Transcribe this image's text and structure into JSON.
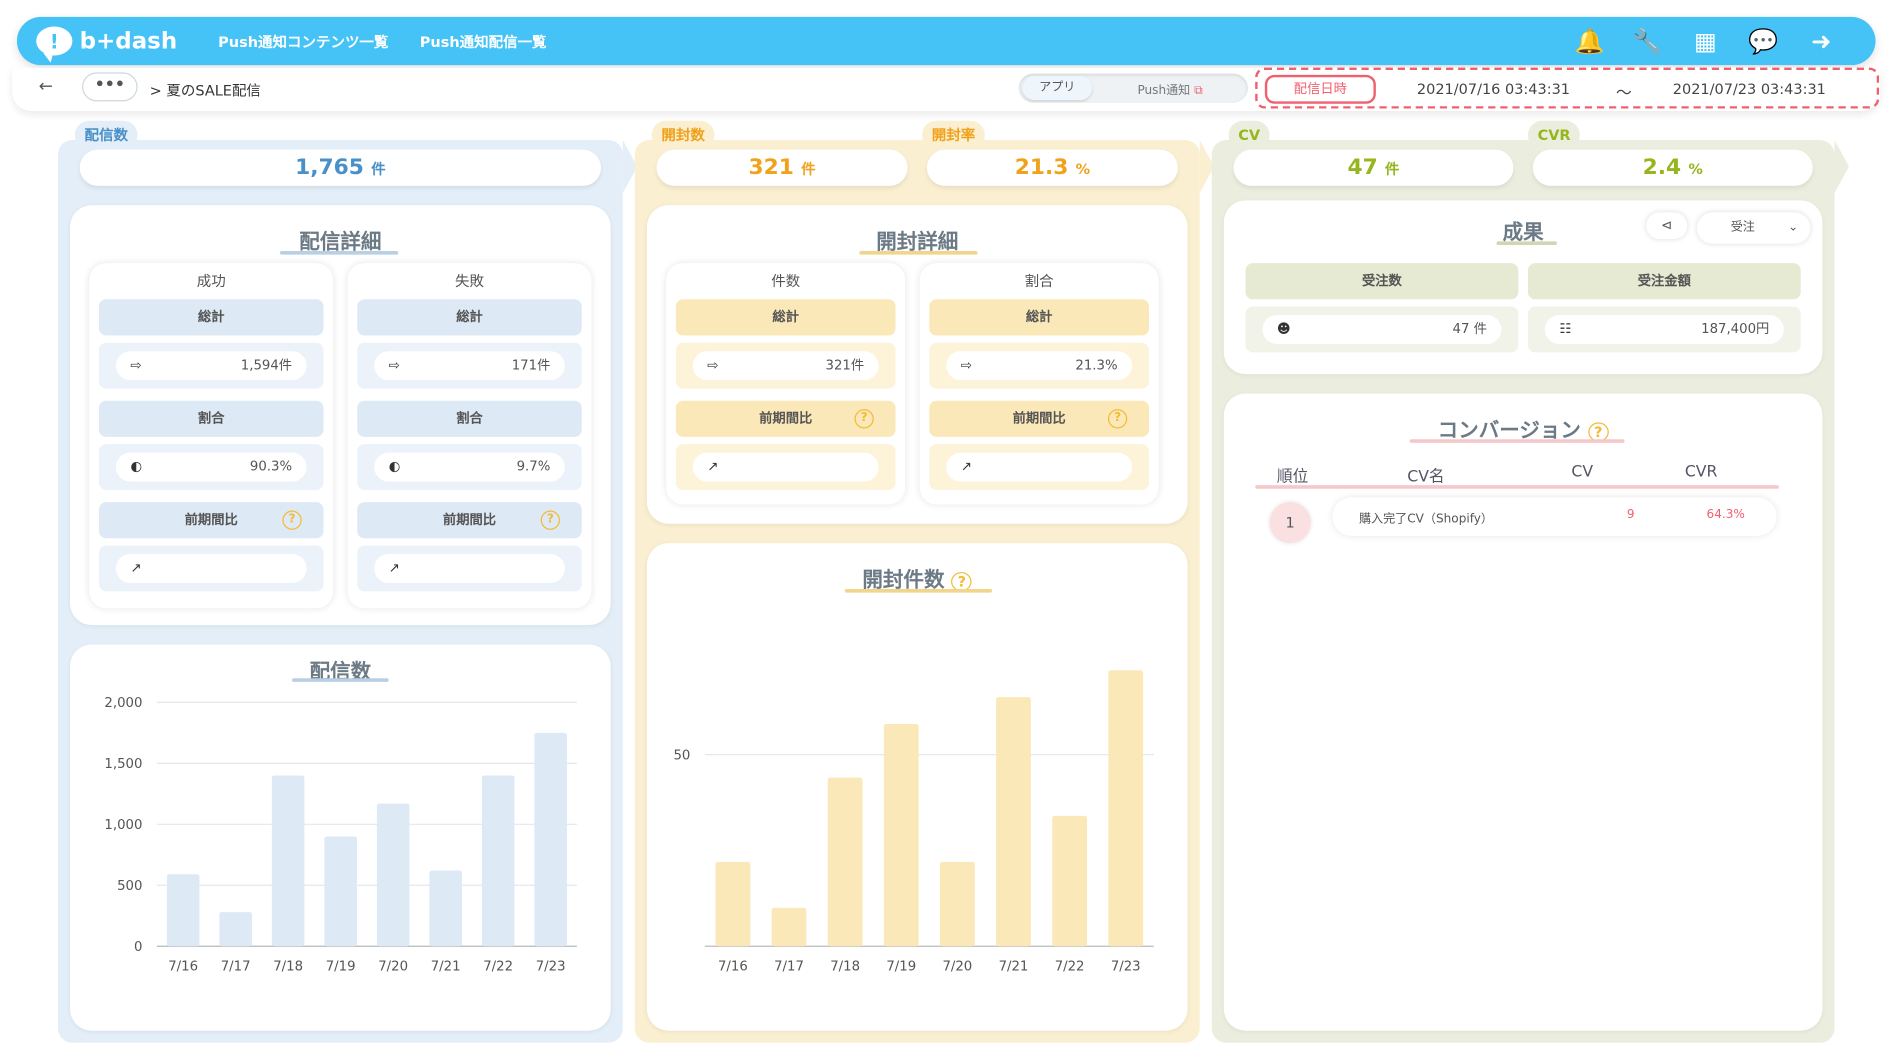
{
  "header": {
    "logo": "b+dash",
    "nav": [
      "Push通知コンテンツ一覧",
      "Push通知配信一覧"
    ],
    "icons": [
      "bell-icon",
      "wrench-icon",
      "grid-icon",
      "chat-icon",
      "logout-icon"
    ]
  },
  "breadcrumb": {
    "more": "•••",
    "current": "> 夏のSALE配信"
  },
  "toggle": {
    "app": "アプリ",
    "push": "Push通知"
  },
  "date": {
    "label": "配信日時",
    "from": "2021/07/16 03:43:31",
    "tilde": "〜",
    "to": "2021/07/23 03:43:31"
  },
  "delivery": {
    "tag": "配信数",
    "total": "1,765",
    "unit": "件",
    "detail_title": "配信詳細",
    "success": {
      "head": "成功",
      "total_label": "総計",
      "total": "1,594件",
      "ratio_label": "割合",
      "ratio": "90.3%",
      "compare_label": "前期間比"
    },
    "failure": {
      "head": "失敗",
      "total_label": "総計",
      "total": "171件",
      "ratio_label": "割合",
      "ratio": "9.7%",
      "compare_label": "前期間比"
    },
    "chart_title": "配信数"
  },
  "open": {
    "tag_count": "開封数",
    "count": "321",
    "count_unit": "件",
    "tag_rate": "開封率",
    "rate": "21.3",
    "rate_unit": "%",
    "detail_title": "開封詳細",
    "count_card": {
      "head": "件数",
      "total_label": "総計",
      "total": "321件",
      "compare_label": "前期間比"
    },
    "ratio_card": {
      "head": "割合",
      "total_label": "総計",
      "total": "21.3%",
      "compare_label": "前期間比"
    },
    "chart_title": "開封件数"
  },
  "result": {
    "tag_cv": "CV",
    "cv": "47",
    "cv_unit": "件",
    "tag_cvr": "CVR",
    "cvr": "2.4",
    "cvr_unit": "%",
    "title": "成果",
    "select": "受注",
    "orders_label": "受注数",
    "orders": "47 件",
    "amount_label": "受注金額",
    "amount": "187,400円",
    "conv_title": "コンバージョン",
    "columns": [
      "順位",
      "CV名",
      "CV",
      "CVR"
    ],
    "rows": [
      {
        "rank": "1",
        "name": "購入完了CV（Shopify）",
        "cv": "9",
        "cvr": "64.3%"
      }
    ]
  },
  "colors": {
    "blue": "#e3eef8",
    "yellow": "#fbefd1",
    "green": "#ebeede",
    "accent_blue": "#4a90c8",
    "accent_orange": "#f0a21c",
    "accent_green": "#95b61c",
    "red": "#f0606e"
  },
  "chart_data": [
    {
      "type": "bar",
      "title": "配信数",
      "categories": [
        "7/16",
        "7/17",
        "7/18",
        "7/19",
        "7/20",
        "7/21",
        "7/22",
        "7/23"
      ],
      "values": [
        590,
        280,
        1400,
        900,
        1170,
        620,
        1400,
        1750
      ],
      "ylim": [
        0,
        2000
      ],
      "yticks": [
        "0",
        "500",
        "1,000",
        "1,500",
        "2,000"
      ],
      "grid": true
    },
    {
      "type": "bar",
      "title": "開封件数",
      "categories": [
        "7/16",
        "7/17",
        "7/18",
        "7/19",
        "7/20",
        "7/21",
        "7/22",
        "7/23"
      ],
      "values": [
        22,
        10,
        44,
        58,
        22,
        65,
        34,
        72
      ],
      "ylim": [
        0,
        80
      ],
      "yticks": [
        "50"
      ],
      "grid": true
    }
  ]
}
